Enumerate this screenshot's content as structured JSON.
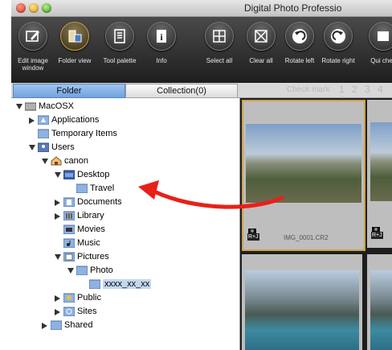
{
  "window": {
    "title": "Digital Photo Professio"
  },
  "toolbar": {
    "buttons": [
      {
        "label": "Edit image window",
        "icon": "edit-image-icon"
      },
      {
        "label": "Folder view",
        "icon": "folder-view-icon"
      },
      {
        "label": "Tool palette",
        "icon": "tool-palette-icon"
      },
      {
        "label": "Info",
        "icon": "info-icon"
      },
      {
        "label": "Select all",
        "icon": "select-all-icon"
      },
      {
        "label": "Clear all",
        "icon": "clear-all-icon"
      },
      {
        "label": "Rotate left",
        "icon": "rotate-left-icon"
      },
      {
        "label": "Rotate right",
        "icon": "rotate-right-icon"
      },
      {
        "label": "Qui chec",
        "icon": "quick-check-icon"
      }
    ]
  },
  "tabs": {
    "folder": "Folder",
    "collection": "Collection(0)"
  },
  "checkmark": {
    "label": "Check mark",
    "numbers": "1 2 3 4 5"
  },
  "tree": [
    {
      "label": "MacOSX",
      "expanded": true
    },
    {
      "label": "Applications",
      "expanded": false
    },
    {
      "label": "Temporary Items"
    },
    {
      "label": "Users",
      "expanded": true
    },
    {
      "label": "canon",
      "expanded": true
    },
    {
      "label": "Desktop",
      "expanded": true
    },
    {
      "label": "Travel"
    },
    {
      "label": "Documents",
      "expanded": false
    },
    {
      "label": "Library",
      "expanded": false
    },
    {
      "label": "Movies"
    },
    {
      "label": "Music"
    },
    {
      "label": "Pictures",
      "expanded": true
    },
    {
      "label": "Photo",
      "expanded": true
    },
    {
      "label": "xxxx_xx_xx",
      "selected": true
    },
    {
      "label": "Public",
      "expanded": false
    },
    {
      "label": "Sites",
      "expanded": false
    },
    {
      "label": "Shared",
      "expanded": false
    }
  ],
  "thumbnails": [
    {
      "filename": "IMG_0001.CR2",
      "badge": "R+J"
    },
    {
      "badge": "R+J"
    }
  ],
  "colors": {
    "accent": "#d0a24a",
    "selection": "#c4d8f0",
    "arrow": "#e8201a"
  }
}
